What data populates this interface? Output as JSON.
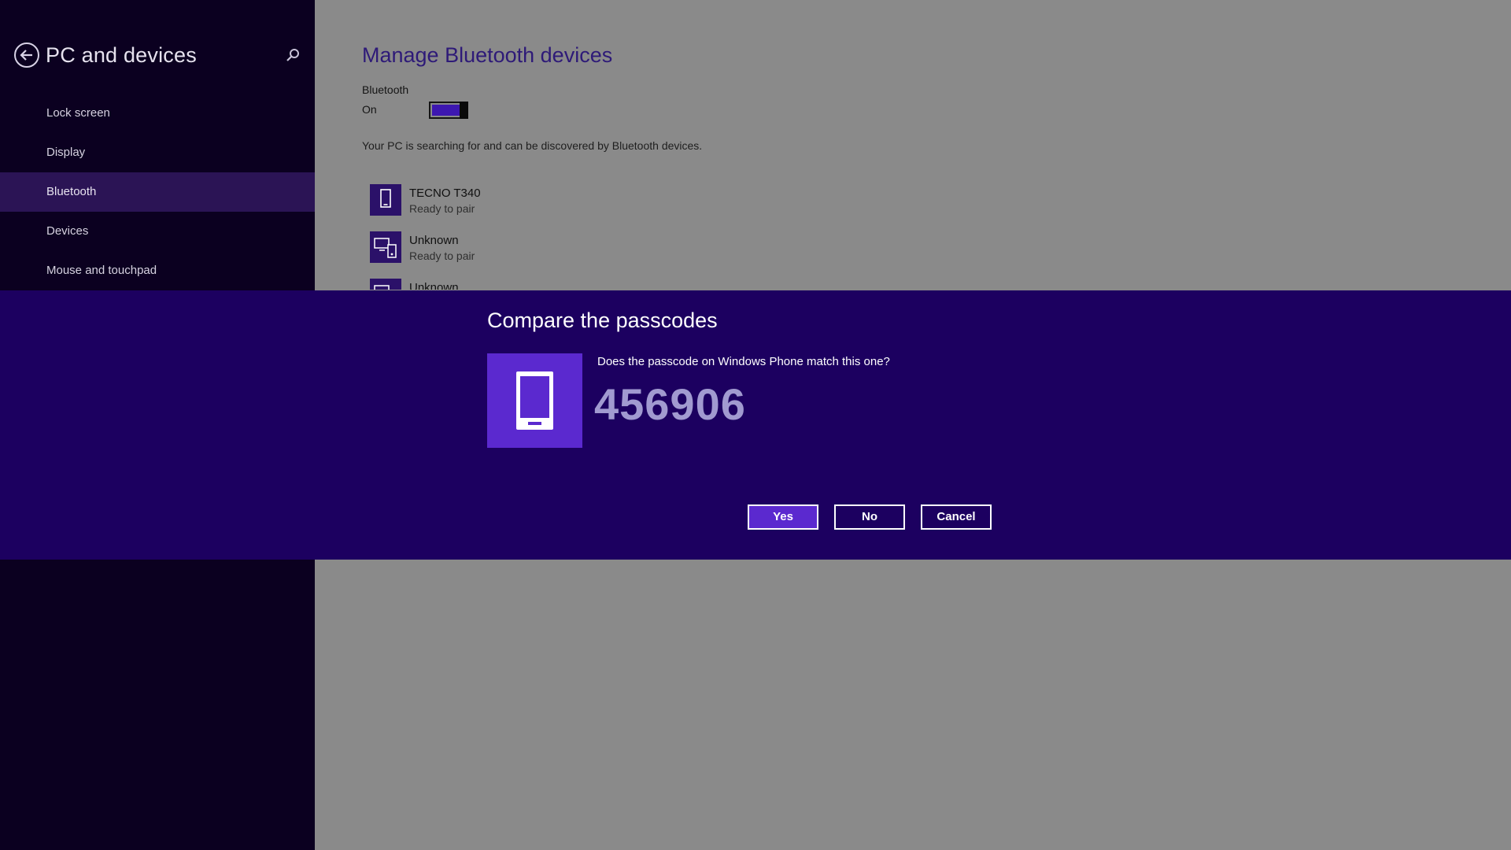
{
  "sidebar": {
    "title": "PC and devices",
    "back_icon": "back-arrow-icon",
    "search_icon": "search-icon",
    "items": [
      {
        "label": "Lock screen"
      },
      {
        "label": "Display"
      },
      {
        "label": "Bluetooth",
        "selected": true
      },
      {
        "label": "Devices"
      },
      {
        "label": "Mouse and touchpad"
      }
    ]
  },
  "main": {
    "title": "Manage Bluetooth devices",
    "bluetooth_label": "Bluetooth",
    "bluetooth_state": "On",
    "bluetooth_on": true,
    "description": "Your PC is searching for and can be discovered by Bluetooth devices.",
    "devices": [
      {
        "name": "TECNO T340",
        "status": "Ready to pair",
        "icon": "phone-icon"
      },
      {
        "name": "Unknown",
        "status": "Ready to pair",
        "icon": "devices-icon"
      },
      {
        "name": "Unknown",
        "status": "",
        "icon": "devices-icon"
      }
    ]
  },
  "dialog": {
    "title": "Compare the passcodes",
    "question": "Does the passcode on Windows Phone match this one?",
    "passcode": "456906",
    "icon": "phone-icon",
    "buttons": {
      "yes": "Yes",
      "no": "No",
      "cancel": "Cancel"
    }
  },
  "colors": {
    "sidebar_bg": "#0b0020",
    "sidebar_selected": "#2b1455",
    "main_bg": "#8a8a8a",
    "accent": "#5b29cf",
    "dialog_bg": "#1c0060",
    "title_color": "#2e1a78",
    "passcode_color": "#a19ad0"
  }
}
